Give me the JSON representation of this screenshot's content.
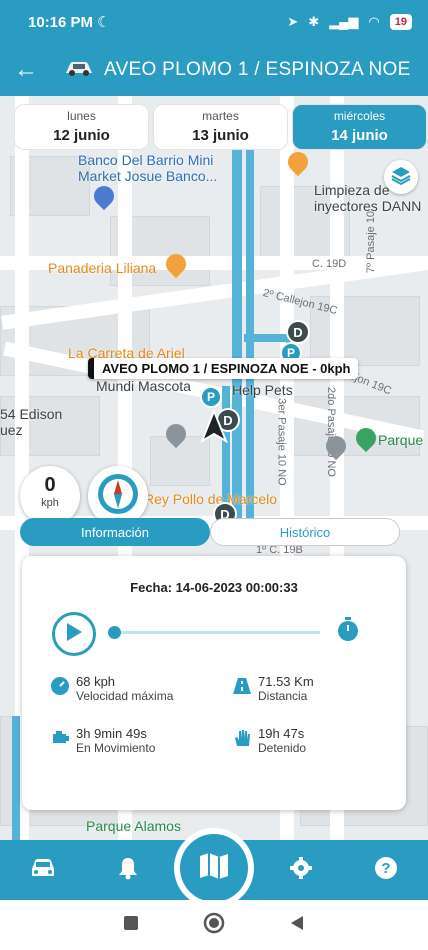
{
  "status": {
    "time": "10:16 PM",
    "battery": "19"
  },
  "appbar": {
    "title": "AVEO PLOMO 1 / ESPINOZA NOE"
  },
  "days": [
    {
      "name": "lunes",
      "date": "12 junio"
    },
    {
      "name": "martes",
      "date": "13 junio"
    },
    {
      "name": "miércoles",
      "date": "14 junio",
      "active": true
    }
  ],
  "map": {
    "pois": {
      "banco": "Banco Del Barrio Mini Market Josue Banco...",
      "limpieza": "Limpieza de inyectores DANN",
      "panaderia": "Panaderia Liliana",
      "carreta": "La Carreta de Ariel",
      "mundi": "Mundi Mascota",
      "help_pets": "Help Pets",
      "edison": "54 Edison",
      "uez": "uez",
      "parque": "Parque",
      "pollo": "Rey Pollo de Marcelo",
      "parque_alamos": "Parque Alamos"
    },
    "streets": {
      "s19d": "C. 19D",
      "callejon2": "2º Callejon 19C",
      "callejon19c": "Callejon 19C",
      "pasaje10": "7º Pasaje 10",
      "pasaje10no": "3er Pasaje 10 NO",
      "pasaje2do": "2do Pasaje 10 NO",
      "c19b": "1º C. 19B"
    },
    "vehicle_label": "AVEO PLOMO 1 / ESPINOZA NOE - 0kph"
  },
  "speed": {
    "value": "0",
    "unit": "kph"
  },
  "tabs": {
    "info": "Información",
    "historico": "Histórico"
  },
  "panel": {
    "fecha": "Fecha: 14-06-2023 00:00:33",
    "stats": {
      "velocidad_value": "68 kph",
      "velocidad_label": "Velocidad máxima",
      "distancia_value": "71.53 Km",
      "distancia_label": "Distancia",
      "movimiento_value": "3h 9min 49s",
      "movimiento_label": "En Movimiento",
      "detenido_value": "19h 47s",
      "detenido_label": "Detenido"
    }
  },
  "colors": {
    "primary": "#2b9cc1",
    "route": "#56b2d6"
  }
}
